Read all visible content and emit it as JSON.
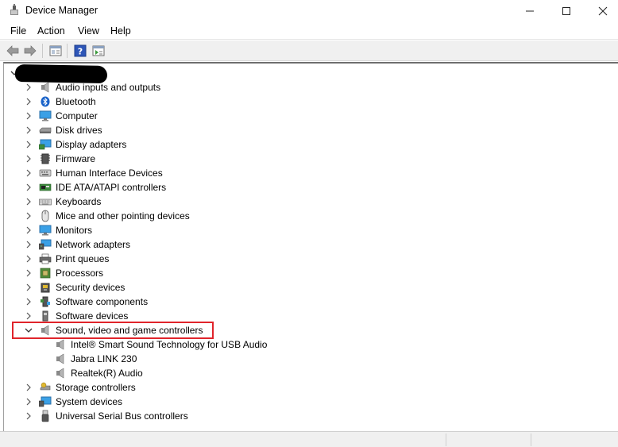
{
  "window": {
    "title": "Device Manager",
    "minimize_glyph": "—",
    "maximize_glyph": "□",
    "close_glyph": "✕"
  },
  "menu": [
    "File",
    "Action",
    "View",
    "Help"
  ],
  "toolbar": {
    "buttons": [
      "back-arrow-icon",
      "forward-arrow-icon",
      "properties-icon",
      "help-icon",
      "update-driver-icon"
    ]
  },
  "tree": {
    "root_label_redacted": true,
    "categories": [
      {
        "label": "Audio inputs and outputs",
        "icon": "speaker-icon",
        "expanded": false
      },
      {
        "label": "Bluetooth",
        "icon": "bluetooth-icon",
        "expanded": false
      },
      {
        "label": "Computer",
        "icon": "computer-icon",
        "expanded": false
      },
      {
        "label": "Disk drives",
        "icon": "disk-drive-icon",
        "expanded": false
      },
      {
        "label": "Display adapters",
        "icon": "display-adapter-icon",
        "expanded": false
      },
      {
        "label": "Firmware",
        "icon": "firmware-icon",
        "expanded": false
      },
      {
        "label": "Human Interface Devices",
        "icon": "hid-icon",
        "expanded": false
      },
      {
        "label": "IDE ATA/ATAPI controllers",
        "icon": "ide-controller-icon",
        "expanded": false
      },
      {
        "label": "Keyboards",
        "icon": "keyboard-icon",
        "expanded": false
      },
      {
        "label": "Mice and other pointing devices",
        "icon": "mouse-icon",
        "expanded": false
      },
      {
        "label": "Monitors",
        "icon": "monitor-icon",
        "expanded": false
      },
      {
        "label": "Network adapters",
        "icon": "network-adapter-icon",
        "expanded": false
      },
      {
        "label": "Print queues",
        "icon": "printer-icon",
        "expanded": false
      },
      {
        "label": "Processors",
        "icon": "processor-icon",
        "expanded": false
      },
      {
        "label": "Security devices",
        "icon": "security-device-icon",
        "expanded": false
      },
      {
        "label": "Software components",
        "icon": "software-component-icon",
        "expanded": false
      },
      {
        "label": "Software devices",
        "icon": "software-device-icon",
        "expanded": false
      },
      {
        "label": "Sound, video and game controllers",
        "icon": "speaker-icon",
        "expanded": true,
        "children": [
          "Intel® Smart Sound Technology for USB Audio",
          "Jabra LINK 230",
          "Realtek(R) Audio"
        ]
      },
      {
        "label": "Storage controllers",
        "icon": "storage-controller-icon",
        "expanded": false
      },
      {
        "label": "System devices",
        "icon": "system-device-icon",
        "expanded": false
      },
      {
        "label": "Universal Serial Bus controllers",
        "icon": "usb-icon",
        "expanded": false
      }
    ]
  },
  "colors": {
    "highlight_border": "#e0242b",
    "toolbar_bg": "#f0f0f0"
  }
}
